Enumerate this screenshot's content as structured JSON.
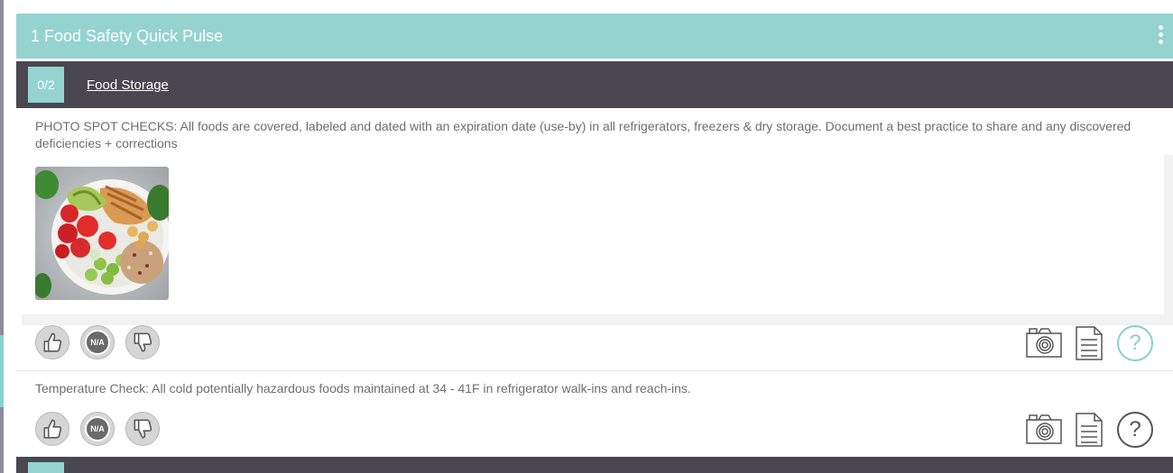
{
  "section": {
    "title": "1 Food Safety Quick Pulse"
  },
  "category": {
    "count": "0/2",
    "title": "Food Storage"
  },
  "questions": [
    {
      "text": "PHOTO SPOT CHECKS: All foods are covered, labeled and dated with an expiration date (use-by) in all refrigerators, freezers & dry storage. Document a best practice to share and any discovered deficiencies + corrections",
      "na_label": "N/A",
      "help_label": "?"
    },
    {
      "text": "Temperature Check: All cold potentially hazardous foods maintained at 34 - 41F in refrigerator walk-ins and reach-ins.",
      "na_label": "N/A",
      "help_label": "?"
    }
  ],
  "colors": {
    "accent": "#94d3d0",
    "category_bg": "#4b4750",
    "text": "#6e6e6e",
    "help_active": "#8ad0cd"
  },
  "icons": [
    "kebab-menu-icon",
    "thumbs-up-icon",
    "na-icon",
    "thumbs-down-icon",
    "camera-icon",
    "document-icon",
    "help-icon"
  ]
}
